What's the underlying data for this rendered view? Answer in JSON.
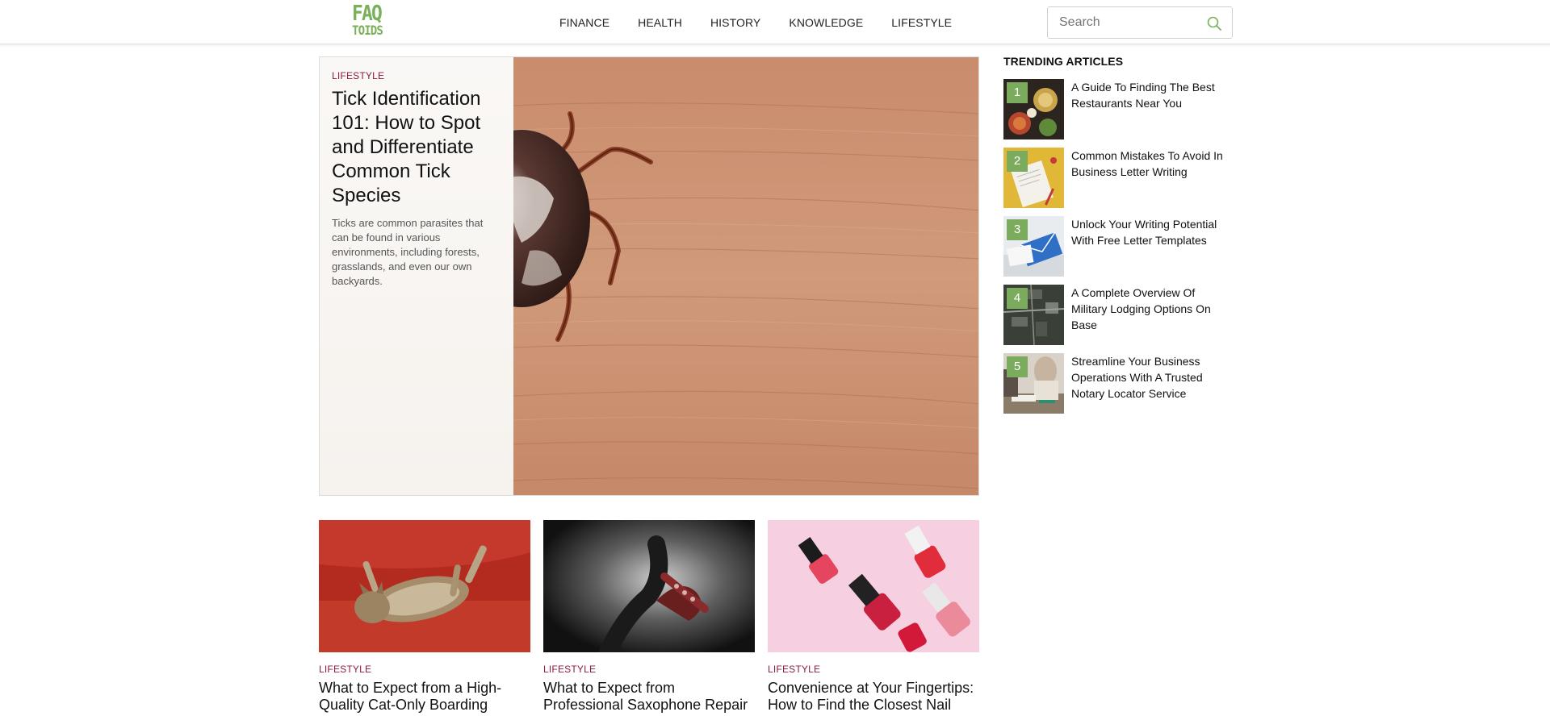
{
  "header": {
    "logo_line1": "FAQ",
    "logo_line2": "TOIDS",
    "nav": [
      "FINANCE",
      "HEALTH",
      "HISTORY",
      "KNOWLEDGE",
      "LIFESTYLE"
    ],
    "search_placeholder": "Search",
    "search_icon": "search-icon"
  },
  "hero": {
    "category": "LIFESTYLE",
    "title": "Tick Identification 101: How to Spot and Differentiate Common Tick Species",
    "excerpt": "Ticks are common parasites that can be found in various environments, including forests, grasslands, and even our own backyards."
  },
  "trending": {
    "heading": "TRENDING ARTICLES",
    "items": [
      {
        "rank": "1",
        "title": "A Guide To Finding The Best Restaurants Near You"
      },
      {
        "rank": "2",
        "title": "Common Mistakes To Avoid In Business Letter Writing"
      },
      {
        "rank": "3",
        "title": "Unlock Your Writing Potential With Free Letter Templates"
      },
      {
        "rank": "4",
        "title": "A Complete Overview Of Military Lodging Options On Base"
      },
      {
        "rank": "5",
        "title": "Streamline Your Business Operations With A Trusted Notary Locator Service"
      }
    ]
  },
  "cards": [
    {
      "category": "LIFESTYLE",
      "title": "What to Expect from a High-Quality Cat-Only Boarding"
    },
    {
      "category": "LIFESTYLE",
      "title": "What to Expect from Professional Saxophone Repair"
    },
    {
      "category": "LIFESTYLE",
      "title": "Convenience at Your Fingertips: How to Find the Closest Nail"
    }
  ],
  "colors": {
    "brand_green": "#7bb05a",
    "category_maroon": "#8b1d3b",
    "rank_badge": "#7bac5d"
  }
}
